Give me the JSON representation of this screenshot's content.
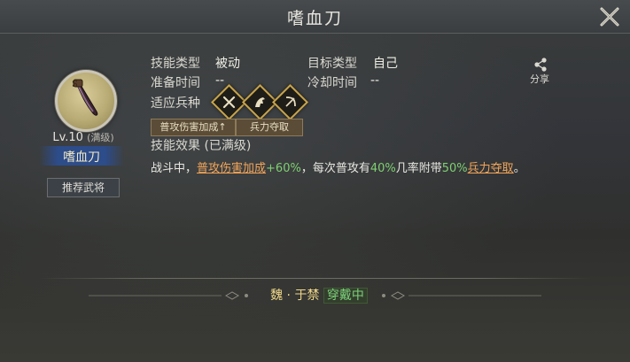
{
  "window": {
    "title": "嗜血刀"
  },
  "skill": {
    "level": "Lv.10",
    "level_note": "(满级)",
    "name": "嗜血刀",
    "recommend_button": "推荐武将"
  },
  "info": {
    "type_label": "技能类型",
    "type_value": "被动",
    "target_label": "目标类型",
    "target_value": "自己",
    "prep_label": "准备时间",
    "prep_value": "--",
    "cd_label": "冷却时间",
    "cd_value": "--",
    "troop_label": "适应兵种",
    "troop_icons": [
      "infantry-icon",
      "cavalry-icon",
      "archer-icon"
    ]
  },
  "tags": [
    "普攻伤害加成↑",
    "兵力夺取"
  ],
  "share_label": "分享",
  "effect": {
    "header": "技能效果 (已满级)",
    "seg1": "战斗中，",
    "link1": "普攻伤害加成",
    "val1": "+60%",
    "seg2": "，每次普攻有",
    "val2": "40%",
    "seg3": "几率附带",
    "val3": "50%",
    "link2": "兵力夺取",
    "seg4": "。"
  },
  "footer": {
    "general": "魏 · 于禁",
    "status": "穿戴中"
  },
  "colors": {
    "accent_orange": "#f2a55a",
    "accent_green": "#7fd072",
    "gold": "#c8a44b"
  }
}
